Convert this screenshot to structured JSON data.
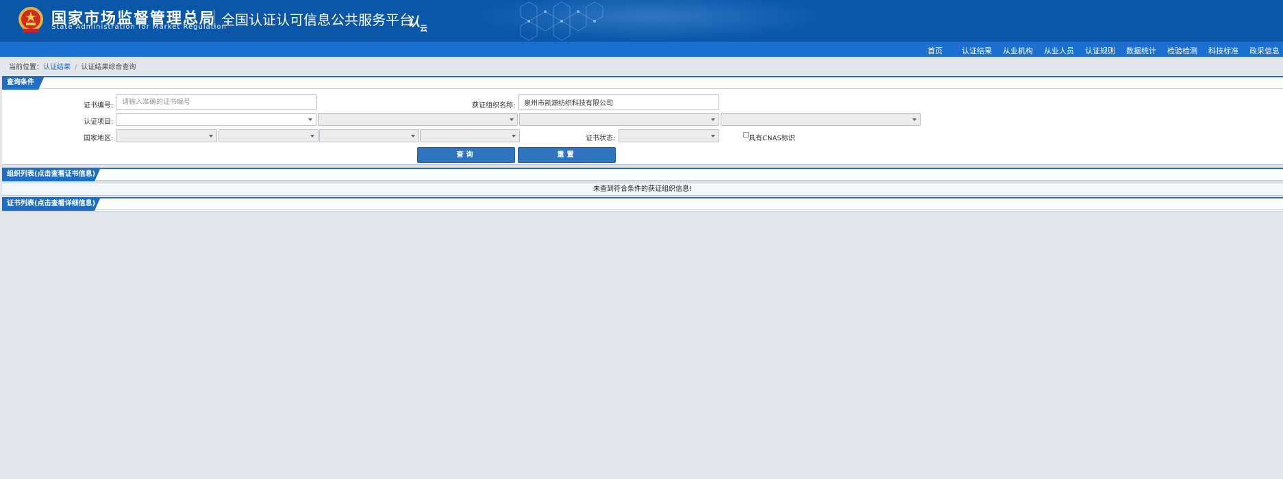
{
  "header": {
    "org_name_cn": "国家市场监督管理总局",
    "org_name_en": "State Administration  for  Market Regulation",
    "platform_title": "全国认证认可信息公共服务平台",
    "logo_text": "认",
    "logo_sub": "云"
  },
  "nav": {
    "items": [
      "首页",
      "认证结果",
      "从业机构",
      "从业人员",
      "认证规则",
      "数据统计",
      "检验检测",
      "科技标准",
      "政采信息"
    ]
  },
  "breadcrumb": {
    "prefix": "当前位置：",
    "link": "认证结果",
    "current": "认证结果综合查询"
  },
  "query_panel": {
    "title": "查询条件",
    "cert_no_label": "证书编号:",
    "cert_no_placeholder": "请输入准确的证书编号",
    "org_name_label": "获证组织名称:",
    "org_name_value": "泉州市凯源纺织科技有限公司",
    "cert_project_label": "认证项目:",
    "region_label": "国家地区:",
    "cert_status_label": "证书状态:",
    "cnas_label": "具有CNAS标识",
    "search_button": "查询",
    "reset_button": "重置"
  },
  "org_panel": {
    "title": "组织列表(点击查看证书信息)",
    "empty_message": "未查到符合条件的获证组织信息!"
  },
  "cert_panel": {
    "title": "证书列表(点击查看详细信息)"
  },
  "colors": {
    "header_bg": "#0a56a8",
    "nav_bg": "#1a6fd1",
    "accent": "#1d6fc5",
    "button": "#2f74bf",
    "page_bg": "#e2e6ea"
  }
}
